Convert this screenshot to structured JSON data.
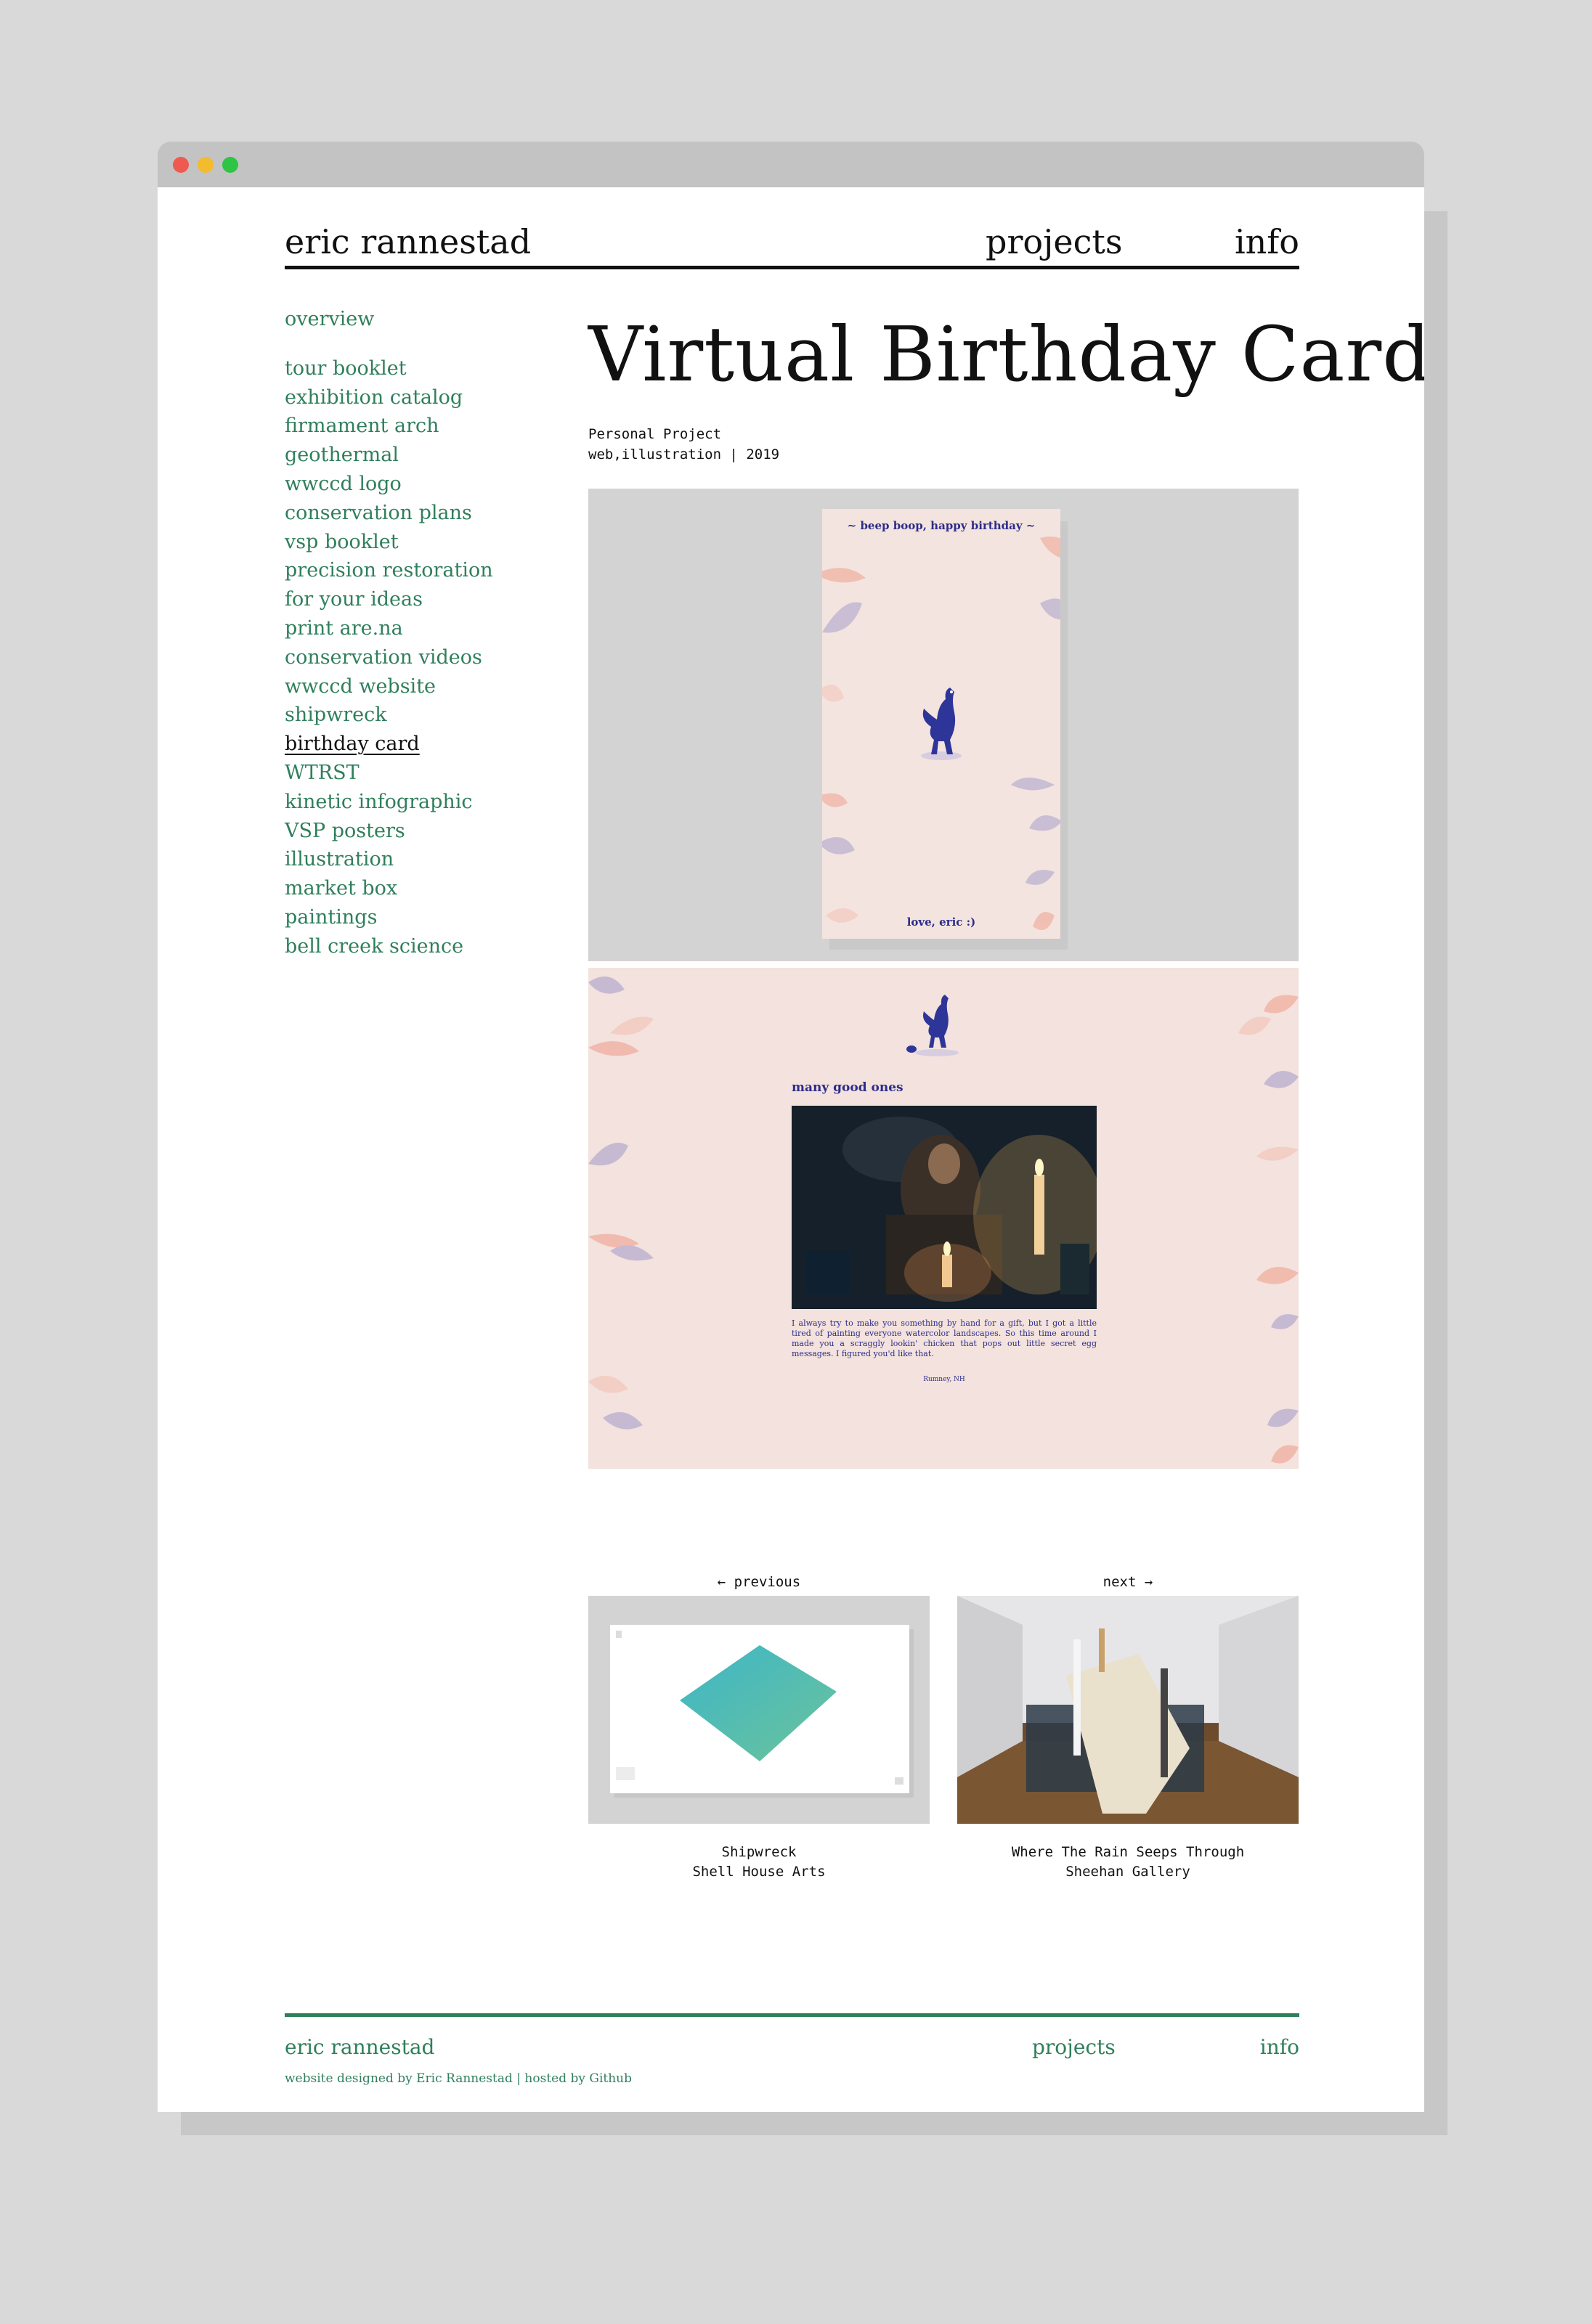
{
  "header": {
    "brand": "eric rannestad",
    "nav_projects": "projects",
    "nav_info": "info"
  },
  "sidebar": {
    "overview": "overview",
    "items": [
      "tour booklet",
      "exhibition catalog",
      "firmament arch",
      "geothermal",
      "wwccd logo",
      "conservation plans",
      "vsp booklet",
      "precision restoration",
      "for your ideas",
      "print are.na",
      "conservation videos",
      "wwccd website",
      "shipwreck",
      "birthday card",
      "WTRST",
      "kinetic infographic",
      "VSP posters",
      "illustration",
      "market box",
      "paintings",
      "bell creek science"
    ],
    "active": "birthday card"
  },
  "main": {
    "title": "Virtual Birthday Card",
    "meta_line1": "Personal Project",
    "meta_line2": "web,illustration | 2019"
  },
  "card1": {
    "top_text": "~ beep boop, happy birthday ~",
    "bottom_text": "love, eric :)"
  },
  "card2": {
    "heading": "many good ones",
    "body": "I always try to make you something by hand for a gift, but I got a little tired of painting everyone watercolor landscapes. So this time around I made you a scraggly lookin' chicken that pops out little secret egg messages. I figured you'd like that.",
    "location": "Rumney, NH"
  },
  "prev": {
    "label": "← previous",
    "title": "Shipwreck",
    "subtitle": "Shell House Arts"
  },
  "next": {
    "label": "next →",
    "title": "Where The Rain Seeps Through",
    "subtitle": "Sheehan Gallery"
  },
  "footer": {
    "brand": "eric rannestad",
    "projects": "projects",
    "info": "info",
    "credit": "website designed by Eric Rannestad | hosted by Github"
  },
  "colors": {
    "accent": "#2f7f5c",
    "text": "#111111",
    "card_ink": "#2c2c8a",
    "card_bg": "#f3e4df"
  }
}
